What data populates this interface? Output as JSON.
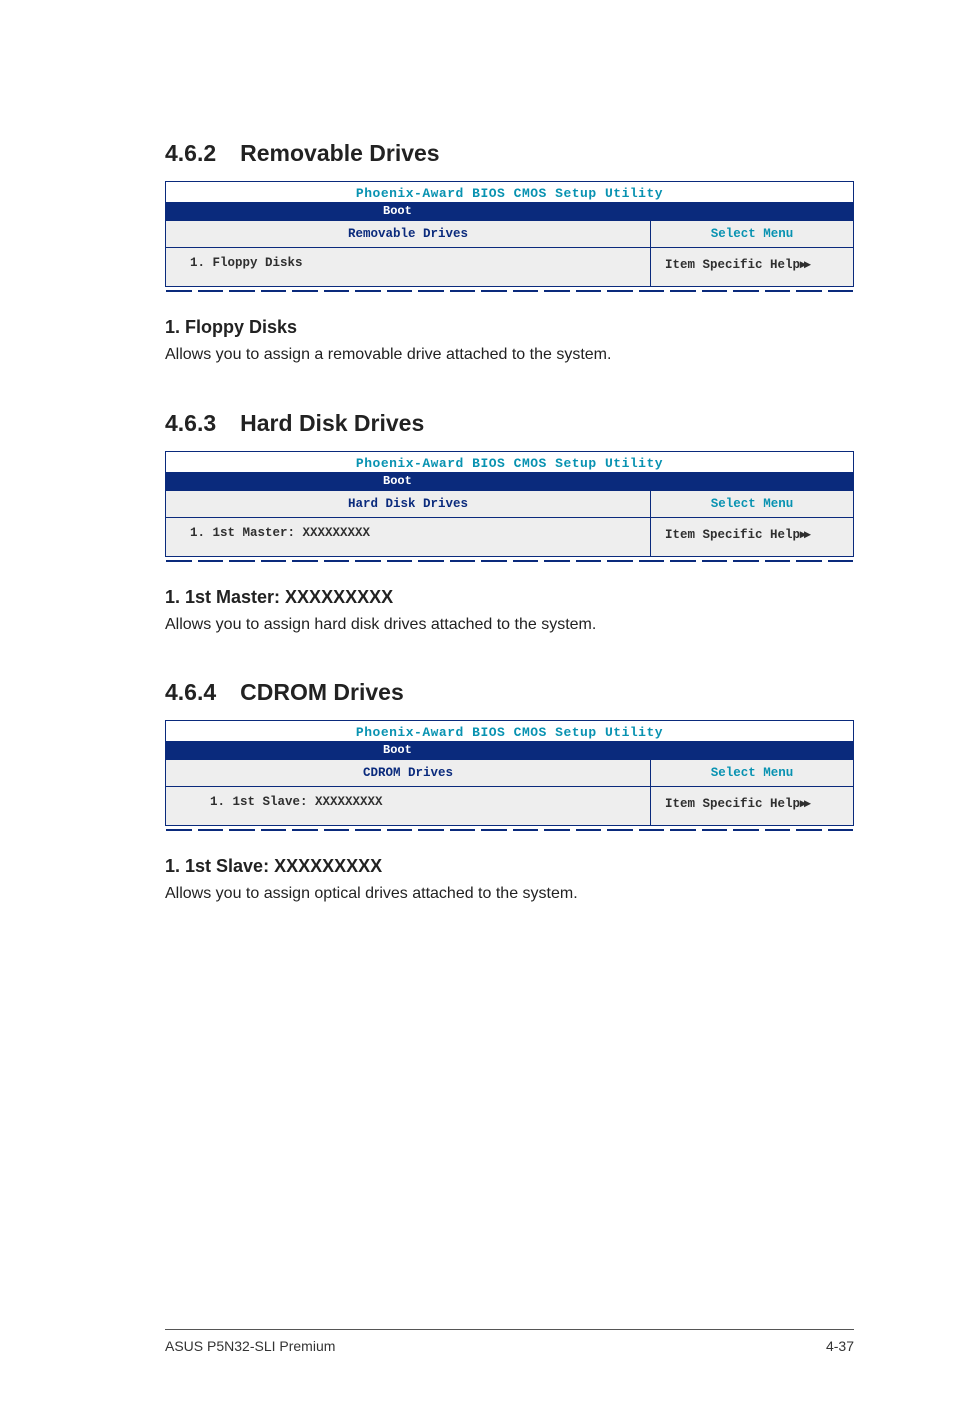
{
  "sections": [
    {
      "number": "4.6.2",
      "title": "Removable Drives",
      "bios": {
        "title": "Phoenix-Award BIOS CMOS Setup Utility",
        "tab": "Boot",
        "left_header": "Removable Drives",
        "right_header": "Select Menu",
        "item_label": "1. Floppy Disks",
        "help_label": "Item Specific Help",
        "item_indent": false
      },
      "sub_heading": "1. Floppy Disks",
      "description": "Allows you to assign a removable drive attached to the system."
    },
    {
      "number": "4.6.3",
      "title": "Hard Disk Drives",
      "bios": {
        "title": "Phoenix-Award BIOS CMOS Setup Utility",
        "tab": "Boot",
        "left_header": "Hard Disk Drives",
        "right_header": "Select Menu",
        "item_label": "1. 1st Master: XXXXXXXXX",
        "help_label": "Item Specific Help",
        "item_indent": false
      },
      "sub_heading": "1. 1st Master: XXXXXXXXX",
      "description": "Allows you to assign hard disk drives attached to the system."
    },
    {
      "number": "4.6.4",
      "title": "CDROM Drives",
      "bios": {
        "title": "Phoenix-Award BIOS CMOS Setup Utility",
        "tab": "Boot",
        "left_header": "CDROM Drives",
        "right_header": "Select Menu",
        "item_label": "1. 1st Slave: XXXXXXXXX",
        "help_label": "Item Specific Help",
        "item_indent": true
      },
      "sub_heading": "1. 1st Slave: XXXXXXXXX",
      "description": "Allows you to assign optical drives attached to the system."
    }
  ],
  "footer": {
    "left": "ASUS P5N32-SLI Premium",
    "right": "4-37"
  },
  "arrows": "▸▸"
}
